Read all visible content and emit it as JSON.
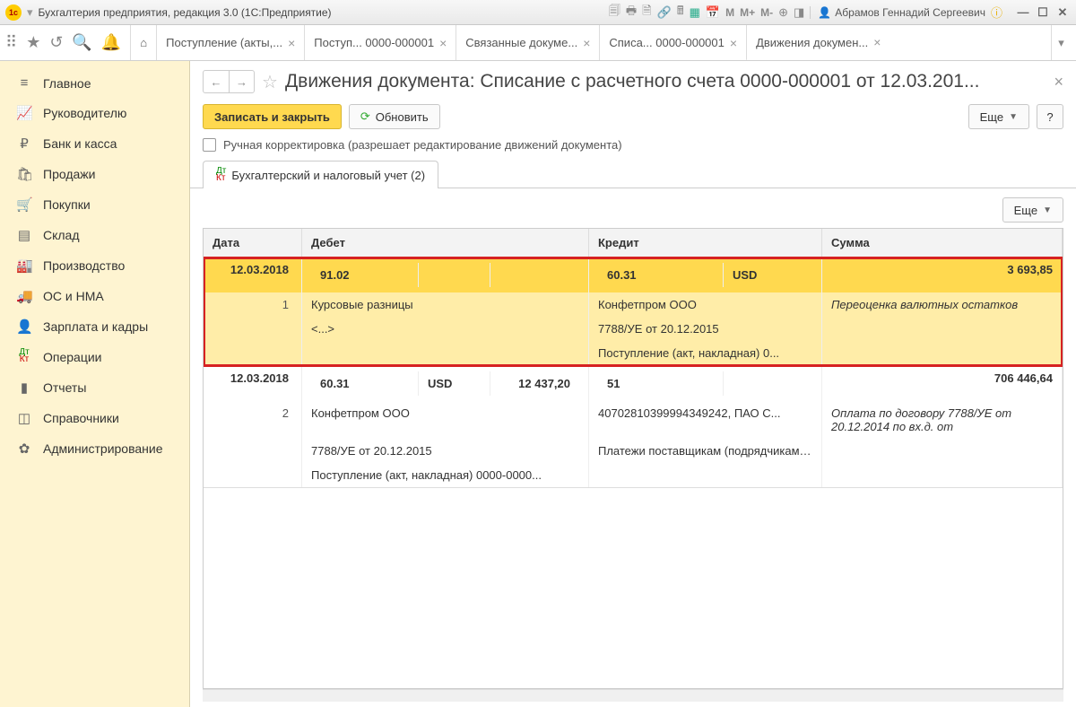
{
  "titlebar": {
    "app": "Бухгалтерия предприятия, редакция 3.0   (1С:Предприятие)",
    "user": "Абрамов Геннадий Сергеевич",
    "m": "M",
    "mp": "M+",
    "mm": "M-"
  },
  "tabs": [
    {
      "label": "Поступление (акты,..."
    },
    {
      "label": "Поступ... 0000-000001"
    },
    {
      "label": "Связанные докуме..."
    },
    {
      "label": "Списа... 0000-000001"
    },
    {
      "label": "Движения докумен..."
    }
  ],
  "nav": [
    {
      "icon": "≡",
      "label": "Главное"
    },
    {
      "icon": "📈",
      "label": "Руководителю"
    },
    {
      "icon": "₽",
      "label": "Банк и касса"
    },
    {
      "icon": "🛍",
      "label": "Продажи"
    },
    {
      "icon": "🛒",
      "label": "Покупки"
    },
    {
      "icon": "▤",
      "label": "Склад"
    },
    {
      "icon": "🏭",
      "label": "Производство"
    },
    {
      "icon": "🚚",
      "label": "ОС и НМА"
    },
    {
      "icon": "👤",
      "label": "Зарплата и кадры"
    },
    {
      "icon": "Дт",
      "label": "Операции"
    },
    {
      "icon": "▮",
      "label": "Отчеты"
    },
    {
      "icon": "◫",
      "label": "Справочники"
    },
    {
      "icon": "✿",
      "label": "Администрирование"
    }
  ],
  "page": {
    "title": "Движения документа: Списание с расчетного счета 0000-000001 от 12.03.201...",
    "save": "Записать и закрыть",
    "refresh": "Обновить",
    "more": "Еще",
    "help": "?",
    "checkbox": "Ручная корректировка (разрешает редактирование движений документа)",
    "subtab": "Бухгалтерский и налоговый учет (2)"
  },
  "headers": {
    "date": "Дата",
    "debit": "Дебет",
    "credit": "Кредит",
    "sum": "Сумма"
  },
  "rows": [
    {
      "date": "12.03.2018",
      "num": "1",
      "d_acc": "91.02",
      "d_cur": "",
      "d_amt": "",
      "cr_acc": "60.31",
      "cr_cur": "USD",
      "sum": "3 693,85",
      "d_sub": [
        "Курсовые разницы",
        "<...>"
      ],
      "cr_sub": [
        "Конфетпром ООО",
        "7788/УЕ от 20.12.2015",
        "Поступление (акт, накладная) 0..."
      ],
      "desc": "Переоценка валютных остатков"
    },
    {
      "date": "12.03.2018",
      "num": "2",
      "d_acc": "60.31",
      "d_cur": "USD",
      "d_amt": "12 437,20",
      "cr_acc": "51",
      "cr_cur": "",
      "sum": "706 446,64",
      "d_sub": [
        "Конфетпром ООО",
        "7788/УЕ от 20.12.2015",
        "Поступление (акт, накладная) 0000-0000..."
      ],
      "cr_sub": [
        "40702810399994349242, ПАО С...",
        "Платежи поставщикам (подрядчикам) за сырье, ..."
      ],
      "desc": "Оплата по договору 7788/УЕ от 20.12.2014 по вх.д.  от"
    }
  ]
}
